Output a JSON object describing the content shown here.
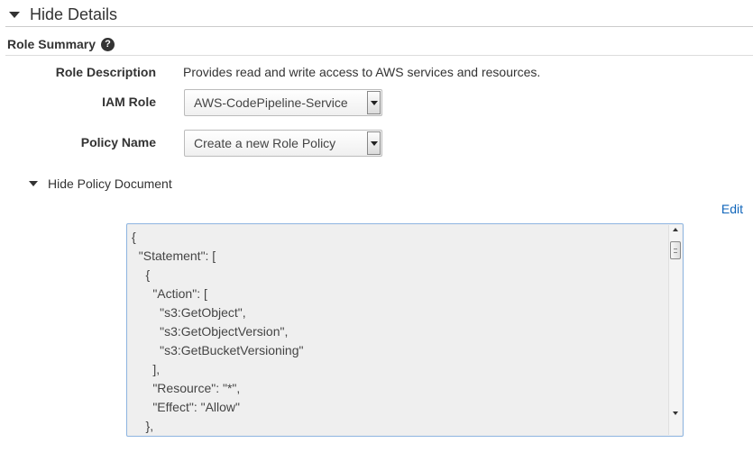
{
  "details_toggle": {
    "label": "Hide Details"
  },
  "role_summary": {
    "title": "Role Summary",
    "help_icon": "question-circle-icon"
  },
  "fields": {
    "role_description": {
      "label": "Role Description",
      "value": "Provides read and write access to AWS services and resources."
    },
    "iam_role": {
      "label": "IAM Role",
      "selected": "AWS-CodePipeline-Service"
    },
    "policy_name": {
      "label": "Policy Name",
      "selected": "Create a new Role Policy"
    }
  },
  "policy_toggle": {
    "label": "Hide Policy Document"
  },
  "edit_link": {
    "label": "Edit"
  },
  "policy_document": {
    "lines": [
      "{",
      "  \"Statement\": [",
      "    {",
      "      \"Action\": [",
      "        \"s3:GetObject\",",
      "        \"s3:GetObjectVersion\",",
      "        \"s3:GetBucketVersioning\"",
      "      ],",
      "      \"Resource\": \"*\",",
      "      \"Effect\": \"Allow\"",
      "    },"
    ]
  },
  "colors": {
    "link": "#1166bb",
    "border": "#8db4e0",
    "code_bg": "#efefef"
  }
}
